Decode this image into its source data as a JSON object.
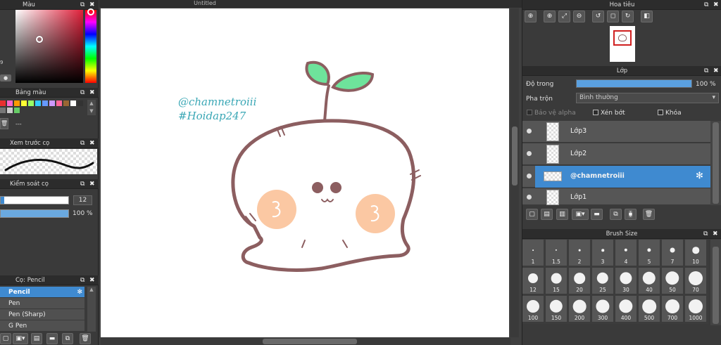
{
  "left": {
    "color_panel": {
      "title": "Màu",
      "value_hint": "9"
    },
    "palette_panel": {
      "title": "Bảng màu",
      "value": "---",
      "swatches": [
        "#e83030",
        "#ff66cc",
        "#ff9900",
        "#ffff33",
        "#99ff66",
        "#33ccff",
        "#6699ff",
        "#cc99ff",
        "#ff6699",
        "#996633",
        "#ffffff",
        "#333333",
        "#777777",
        "#cccccc",
        "#66cc66"
      ]
    },
    "preview_panel": {
      "title": "Xem trước cọ"
    },
    "control_panel": {
      "title": "Kiểm soát cọ",
      "size": "12",
      "opacity": "100 %"
    },
    "brush_panel": {
      "title": "Cọ: Pencil",
      "items": [
        "Pencil",
        "Pen",
        "Pen (Sharp)",
        "G Pen"
      ],
      "selected": 0
    }
  },
  "canvas": {
    "title": "Untitled",
    "watermark_line1": "@chamnetroiii",
    "watermark_line2": "#Hoidap247",
    "colors": {
      "outline": "#8c5e60",
      "leaf": "#6ee39b",
      "cheek": "#fbc8a3",
      "text": "#3aa7b5"
    }
  },
  "right": {
    "navigator": {
      "title": "Hoa tiêu"
    },
    "layers": {
      "title": "Lớp",
      "opacity_label": "Độ trong",
      "opacity_value": "100 %",
      "opacity_fraction": 1.0,
      "blend_label": "Pha trộn",
      "blend_value": "Bình thường",
      "protect_alpha": "Bảo vệ alpha",
      "clipping": "Xén bớt",
      "lock": "Khóa",
      "items": [
        {
          "name": "Lớp3",
          "selected": false
        },
        {
          "name": "Lớp2",
          "selected": false
        },
        {
          "name": "@chamnetroiii",
          "selected": true
        },
        {
          "name": "Lớp1",
          "selected": false
        }
      ]
    },
    "brush_size": {
      "title": "Brush Size",
      "sizes": [
        "1",
        "1.5",
        "2",
        "3",
        "4",
        "5",
        "7",
        "10",
        "12",
        "15",
        "20",
        "25",
        "30",
        "40",
        "50",
        "70",
        "100",
        "150",
        "200",
        "300",
        "400",
        "500",
        "700",
        "1000"
      ]
    }
  }
}
